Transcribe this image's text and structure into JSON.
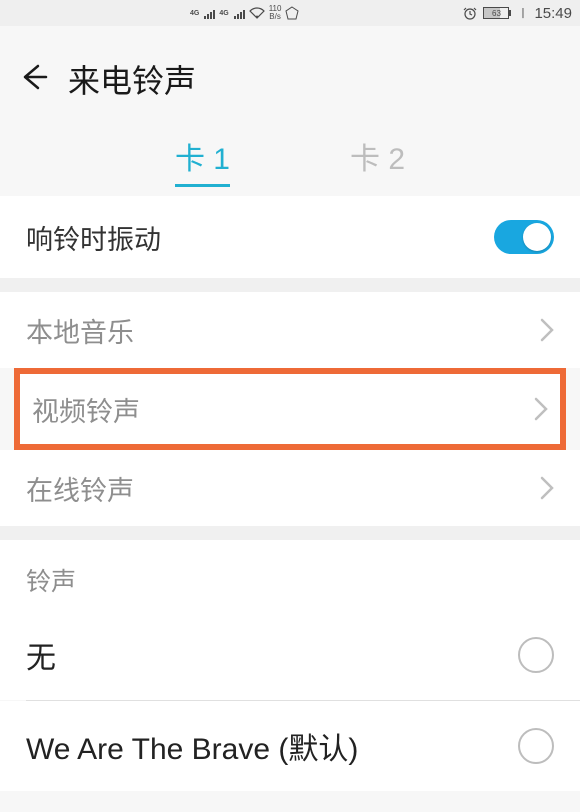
{
  "status": {
    "net4g": "4G",
    "bs": "B/s",
    "bsn": "110",
    "battery": "63",
    "time": "15:49"
  },
  "header": {
    "title": "来电铃声"
  },
  "tabs": {
    "items": [
      {
        "label": "卡 1",
        "active": true
      },
      {
        "label": "卡 2",
        "active": false
      }
    ]
  },
  "vibrate": {
    "label": "响铃时振动",
    "on": true
  },
  "sources": {
    "local": "本地音乐",
    "video": "视频铃声",
    "online": "在线铃声"
  },
  "ringtone_section": {
    "header": "铃声",
    "options": [
      {
        "label": "无",
        "selected": false
      },
      {
        "label": "We Are The Brave (默认)",
        "selected": false
      }
    ]
  }
}
